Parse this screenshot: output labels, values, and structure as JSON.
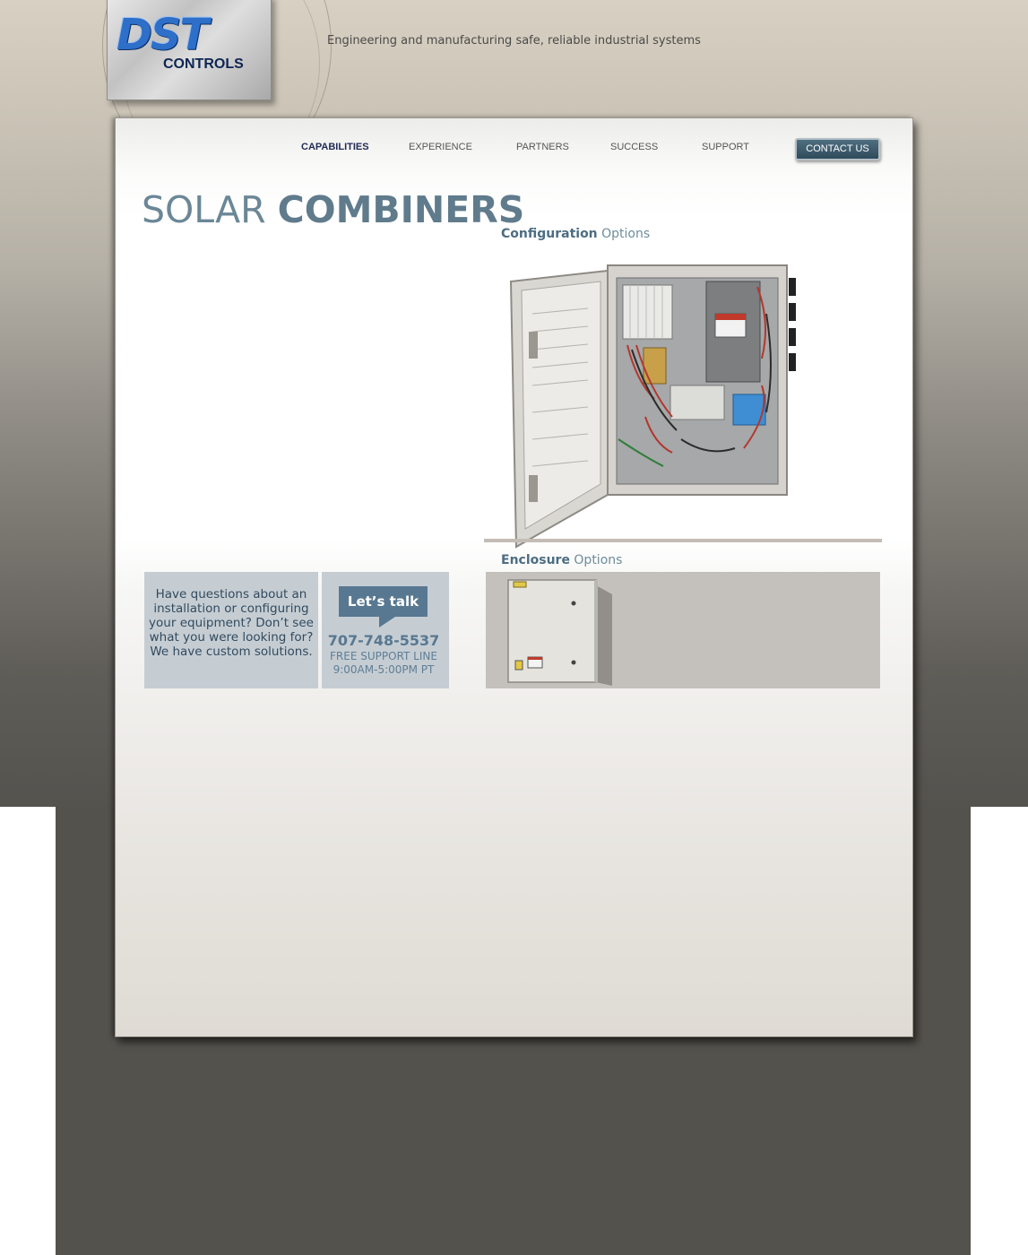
{
  "brand": {
    "logo_text": "DST",
    "logo_subtext": "CONTROLS",
    "tagline": "Engineering and manufacturing safe, reliable industrial systems"
  },
  "nav": {
    "items": [
      {
        "label": "CAPABILITIES",
        "active": true
      },
      {
        "label": "EXPERIENCE",
        "active": false
      },
      {
        "label": "PARTNERS",
        "active": false
      },
      {
        "label": "SUCCESS",
        "active": false
      },
      {
        "label": "SUPPORT",
        "active": false
      }
    ],
    "contact_label": "CONTACT US"
  },
  "page": {
    "title_light": "SOLAR",
    "title_bold": "COMBINERS"
  },
  "configuration": {
    "heading_bold": "Configuration",
    "heading_light": "Options"
  },
  "enclosure": {
    "heading_bold": "Enclosure",
    "heading_light": "Options"
  },
  "help": {
    "questions_text": "Have questions about an installation or configuring your equipment? Don’t see what you were looking for? We have custom solutions.",
    "talk_label": "Let’s talk",
    "phone": "707-748-5537",
    "support_line": "FREE SUPPORT LINE",
    "support_hours": "9:00AM-5:00PM PT"
  },
  "colors": {
    "accent": "#587891",
    "nav_active": "#1f2a55",
    "contact_button": "#2f4b5b",
    "title": "#6b8797"
  }
}
